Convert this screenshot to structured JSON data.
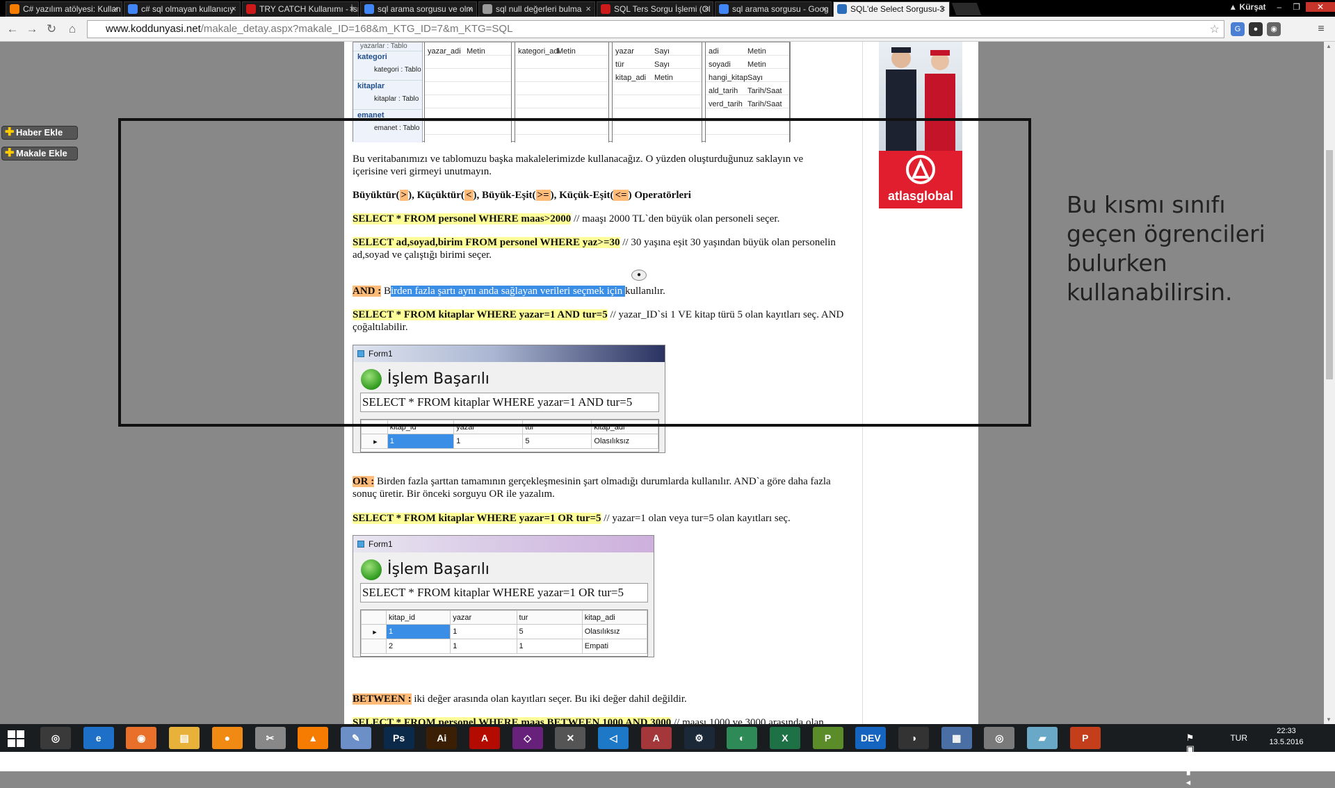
{
  "tabs": [
    {
      "title": "C# yazılım atölyesi: Kullan",
      "color": "#f57d00"
    },
    {
      "title": "c# sql olmayan kullanıcıy",
      "color": "#4285f4"
    },
    {
      "title": "TRY CATCH Kullanımı - İsr",
      "color": "#cc1a1a"
    },
    {
      "title": "sql arama sorgusu ve olm",
      "color": "#4285f4"
    },
    {
      "title": "sql null değerleri bulma",
      "color": "#999999"
    },
    {
      "title": "SQL Ters Sorgu İşlemi (Ol",
      "color": "#cc1a1a"
    },
    {
      "title": "sql arama sorgusu - Goog",
      "color": "#4285f4"
    },
    {
      "title": "SQL'de Select Sorgusu-3",
      "color": "#2a6ebb"
    }
  ],
  "user_name": "Kürşat",
  "address": {
    "host": "www.koddunyasi.net",
    "path": "/makale_detay.aspx?makale_ID=168&m_KTG_ID=7&m_KTG=SQL"
  },
  "side_buttons": {
    "haber": "Haber Ekle",
    "makale": "Makale Ekle"
  },
  "db_diagram": {
    "tables": [
      {
        "name": "kategori",
        "sub": "kategori : Tablo"
      },
      {
        "name": "kitaplar",
        "sub": "kitaplar : Tablo"
      },
      {
        "name": "emanet",
        "sub": "emanet : Tablo"
      }
    ],
    "top_label": "yazarlar : Tablo",
    "col1": [
      [
        "yazar_adi",
        "Metin"
      ]
    ],
    "col2": [
      [
        "kategori_adi",
        "Metin"
      ]
    ],
    "col3": [
      [
        "yazar",
        "Sayı"
      ],
      [
        "tür",
        "Sayı"
      ],
      [
        "kitap_adi",
        "Metin"
      ]
    ],
    "col4": [
      [
        "adi",
        "Metin"
      ],
      [
        "soyadi",
        "Metin"
      ],
      [
        "hangi_kitap",
        "Sayı"
      ],
      [
        "ald_tarih",
        "Tarih/Saat"
      ],
      [
        "verd_tarih",
        "Tarih/Saat"
      ]
    ]
  },
  "article": {
    "intro": "Bu veritabanımızı ve tablomuzu başka makalelerimizde kullanacağız. O yüzden oluşturduğunuz saklayın ve içerisine veri girmeyi unutmayın.",
    "ops_heading": {
      "a": "Büyüktür(",
      ">": ">",
      "b": "), Küçüktür(",
      "<": "<",
      "c": "), Büyük-Eşit(",
      ">=": ">=",
      "d": "), Küçük-Eşit(",
      "<=": "<=",
      "e": ") Operatörleri"
    },
    "q1": "SELECT * FROM personel WHERE maas>2000",
    "q1c": " // maaşı 2000 TL`den büyük olan personeli seçer.",
    "q2": "SELECT ad,soyad,birim FROM personel WHERE yaz>=30",
    "q2c": " // 30 yaşına eşit 30 yaşından büyük olan personelin ad,soyad ve çalıştığı birimi seçer.",
    "and_label": "AND :",
    "and_b": " B",
    "and_sel": "irden fazla şartı aynı anda sağlayan verileri seçmek için ",
    "and_rest": "kullanılır.",
    "q3": "SELECT * FROM kitaplar WHERE yazar=1 AND tur=5",
    "q3c": " // yazar_ID`si 1 VE kitap türü 5 olan kayıtları seç. AND çoğaltılabilir.",
    "or_label": "OR :",
    "or_text": " Birden fazla şarttan tamamının gerçekleşmesinin şart olmadığı durumlarda kullanılır. AND`a göre daha fazla sonuç üretir. Bir önceki sorguyu OR ile yazalım.",
    "q4": "SELECT * FROM kitaplar WHERE yazar=1 OR tur=5",
    "q4c": " // yazar=1 olan veya tur=5 olan kayıtları seç.",
    "between_label": "BETWEEN :",
    "between_text": " iki değer arasında olan kayıtları seçer. Bu iki değer dahil değildir.",
    "q5": "SELECT * FROM personel WHERE maas BETWEEN 1000 AND 3000",
    "q5c": " // maaşı 1000 ve 3000 arasında olan"
  },
  "form1": {
    "title": "Form1",
    "message": "İşlem Başarılı",
    "sql": "SELECT * FROM kitaplar WHERE yazar=1 AND tur=5",
    "headers": [
      "kitap_id",
      "yazar",
      "tur",
      "kitap_adi"
    ],
    "rows": [
      [
        "1",
        "1",
        "5",
        "Olasılıksız"
      ]
    ]
  },
  "form2": {
    "title": "Form1",
    "message": "İşlem Başarılı",
    "sql": "SELECT * FROM kitaplar WHERE yazar=1 OR tur=5",
    "headers": [
      "kitap_id",
      "yazar",
      "tur",
      "kitap_adi"
    ],
    "rows": [
      [
        "1",
        "1",
        "5",
        "Olasılıksız"
      ],
      [
        "2",
        "1",
        "1",
        "Empati"
      ]
    ]
  },
  "ad": {
    "brand": "atlasglobal",
    "color": "#e01e2e"
  },
  "note": "Bu kısmı sınıfı geçen ögrencileri bulurken kullanabilirsin.",
  "taskbar_apps": [
    {
      "name": "chrome",
      "label": "◎",
      "color": "#3a3a3a"
    },
    {
      "name": "ie",
      "label": "e",
      "color": "#1e6fc8"
    },
    {
      "name": "firefox",
      "label": "◉",
      "color": "#e8702a"
    },
    {
      "name": "explorer",
      "label": "▤",
      "color": "#e8b13a"
    },
    {
      "name": "app-orange",
      "label": "●",
      "color": "#f08a12"
    },
    {
      "name": "snipping",
      "label": "✂",
      "color": "#888888"
    },
    {
      "name": "vlc",
      "label": "▲",
      "color": "#f57c00"
    },
    {
      "name": "paint",
      "label": "✎",
      "color": "#6d8fc7"
    },
    {
      "name": "photoshop",
      "label": "Ps",
      "color": "#0b2a4a"
    },
    {
      "name": "illustrator",
      "label": "Ai",
      "color": "#3a1f05"
    },
    {
      "name": "acrobat",
      "label": "A",
      "color": "#b30b00"
    },
    {
      "name": "visual-studio",
      "label": "◇",
      "color": "#68217a"
    },
    {
      "name": "tools",
      "label": "✕",
      "color": "#555555"
    },
    {
      "name": "vscode",
      "label": "◁",
      "color": "#1e78c8"
    },
    {
      "name": "access",
      "label": "A",
      "color": "#a4373a"
    },
    {
      "name": "steam",
      "label": "⚙",
      "color": "#1b2838"
    },
    {
      "name": "network",
      "label": "◐",
      "color": "#2e8b57"
    },
    {
      "name": "excel",
      "label": "X",
      "color": "#1e7145"
    },
    {
      "name": "project",
      "label": "P",
      "color": "#5b8c2a"
    },
    {
      "name": "devcpp",
      "label": "DEV",
      "color": "#1565c0"
    },
    {
      "name": "app-dark",
      "label": "◑",
      "color": "#333333"
    },
    {
      "name": "calculator",
      "label": "▦",
      "color": "#4a6fa5"
    },
    {
      "name": "disc",
      "label": "◎",
      "color": "#7a7a7a"
    },
    {
      "name": "notes",
      "label": "▰",
      "color": "#6aa8c8"
    },
    {
      "name": "powerpoint",
      "label": "P",
      "color": "#c43e1c"
    }
  ],
  "tray": {
    "lang": "TUR",
    "time": "22:33",
    "date": "13.5.2016"
  }
}
